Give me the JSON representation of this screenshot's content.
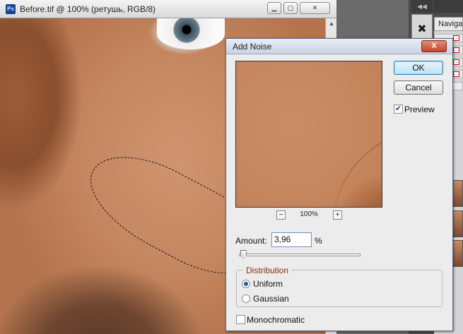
{
  "document": {
    "title": "Before.tif @ 100% (ретушь, RGB/8)",
    "app_icon": "Ps",
    "window_buttons": [
      "minimize",
      "maximize",
      "close"
    ]
  },
  "panels": {
    "top_arrows": "◀◀",
    "navigator_tab": "Navigat",
    "tool_icon": "tools-icon"
  },
  "dialog": {
    "title": "Add Noise",
    "close_label": "X",
    "ok_label": "OK",
    "cancel_label": "Cancel",
    "preview_label": "Preview",
    "preview_checked": true,
    "zoom_out_label": "−",
    "zoom_in_label": "+",
    "zoom_level": "100%",
    "amount_label": "Amount:",
    "amount_value": "3,96",
    "amount_unit": "%",
    "distribution_label": "Distribution",
    "distribution_options": [
      "Uniform",
      "Gaussian"
    ],
    "distribution_selected": "Uniform",
    "monochromatic_label": "Monochromatic",
    "monochromatic_checked": false
  }
}
